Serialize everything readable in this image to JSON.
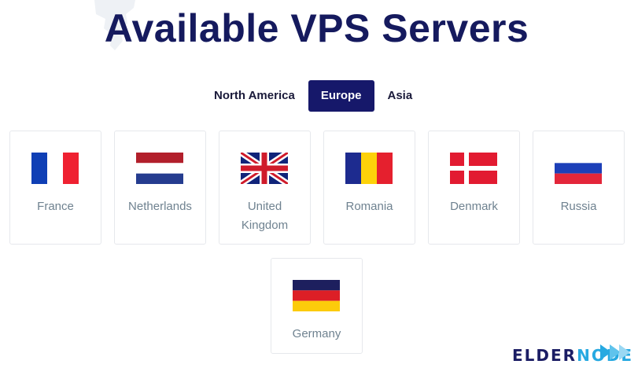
{
  "header": {
    "title": "Available VPS Servers"
  },
  "tabs": [
    {
      "label": "North America",
      "active": false
    },
    {
      "label": "Europe",
      "active": true
    },
    {
      "label": "Asia",
      "active": false
    }
  ],
  "locations": [
    {
      "label": "France",
      "flag": "france-flag"
    },
    {
      "label": "Netherlands",
      "flag": "netherlands-flag"
    },
    {
      "label": "United\nKingdom",
      "flag": "uk-flag"
    },
    {
      "label": "Romania",
      "flag": "romania-flag"
    },
    {
      "label": "Denmark",
      "flag": "denmark-flag"
    },
    {
      "label": "Russia",
      "flag": "russia-flag"
    },
    {
      "label": "Germany",
      "flag": "germany-flag"
    }
  ],
  "brand": {
    "logo_part1": "ELDER",
    "logo_part2": "NODE"
  },
  "colors": {
    "title": "#151a5e",
    "active_tab": "#16186a",
    "label": "#6f8290",
    "brand_dark": "#1b1d64",
    "brand_light": "#27a9e1"
  }
}
